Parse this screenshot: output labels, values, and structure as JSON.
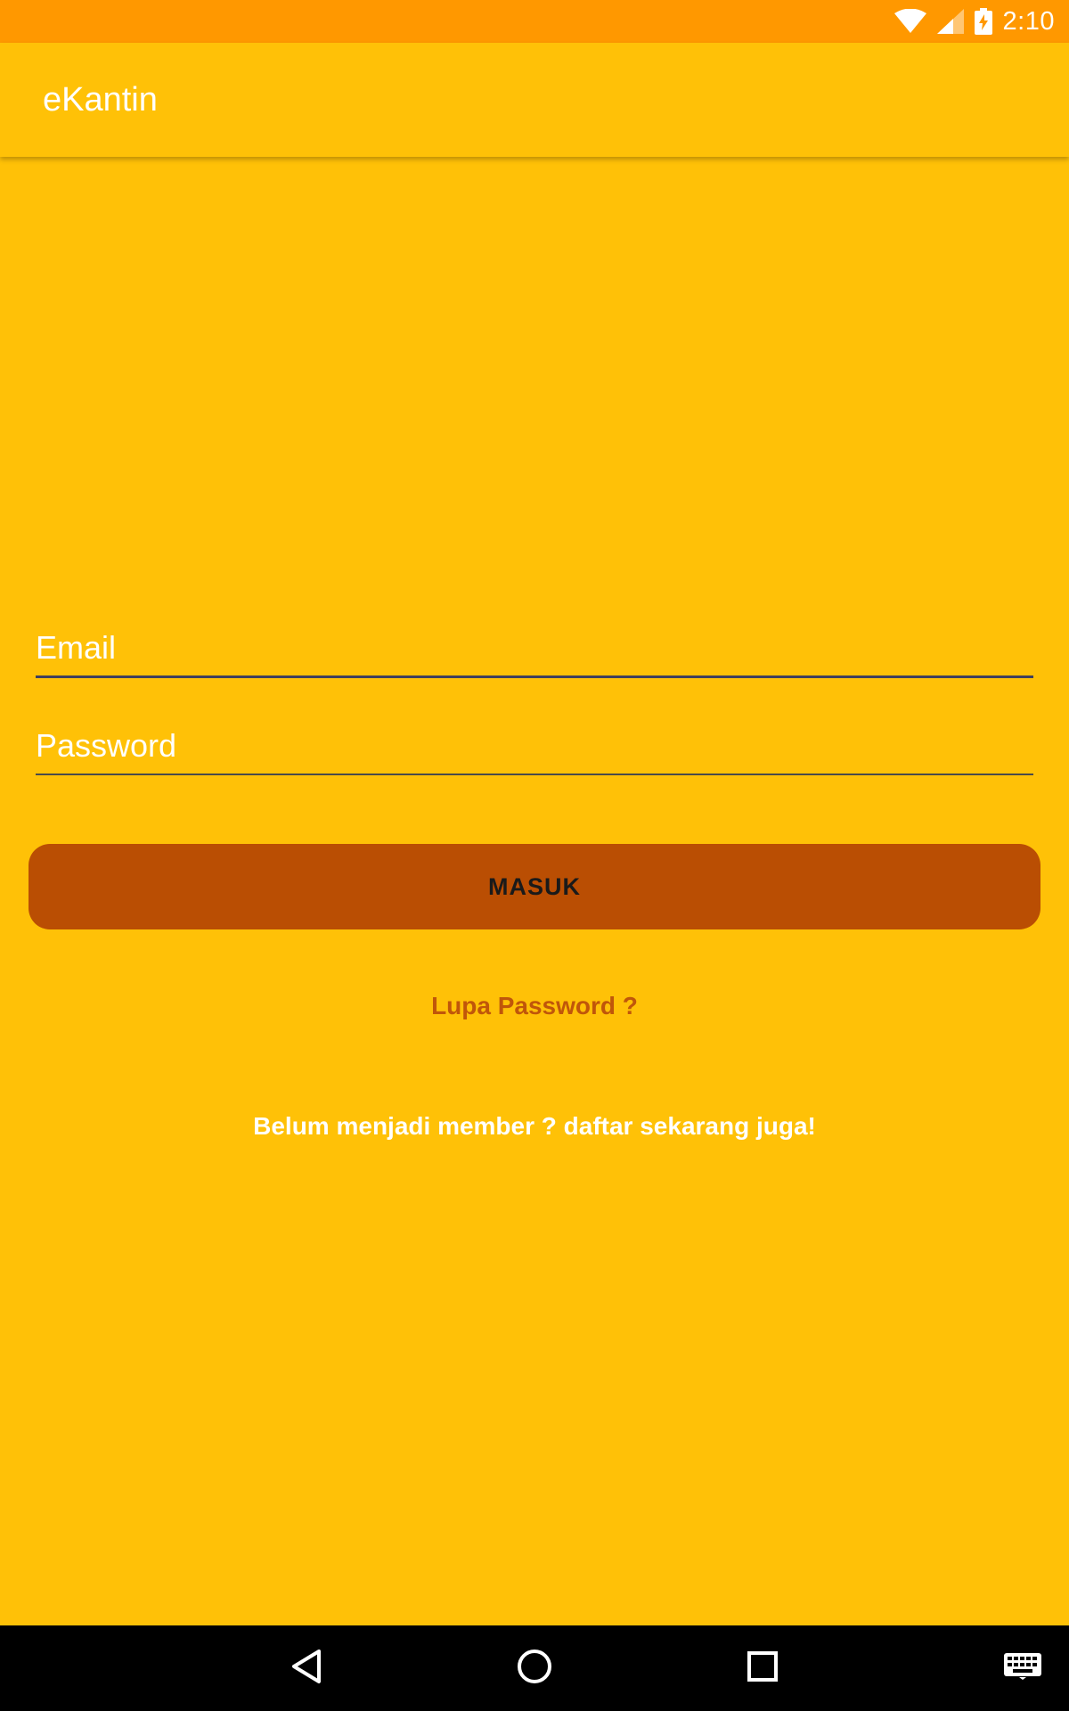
{
  "status_bar": {
    "time": "2:10",
    "icons": [
      "wifi-icon",
      "cellular-signal-icon",
      "battery-charging-icon"
    ]
  },
  "app_bar": {
    "title": "eKantin"
  },
  "login_form": {
    "email_placeholder": "Email",
    "password_placeholder": "Password",
    "login_button_label": "MASUK",
    "forgot_password_link": "Lupa Password ?",
    "register_link": "Belum menjadi member ? daftar sekarang juga!"
  },
  "nav_bar": {
    "icons": [
      "back-icon",
      "home-icon",
      "recents-icon",
      "keyboard-icon"
    ]
  },
  "colors": {
    "status_bar": "#FF9800",
    "background": "#FFC107",
    "button": "#BA4E03",
    "forgot_link": "#C0560A",
    "nav_bar": "#000000"
  }
}
